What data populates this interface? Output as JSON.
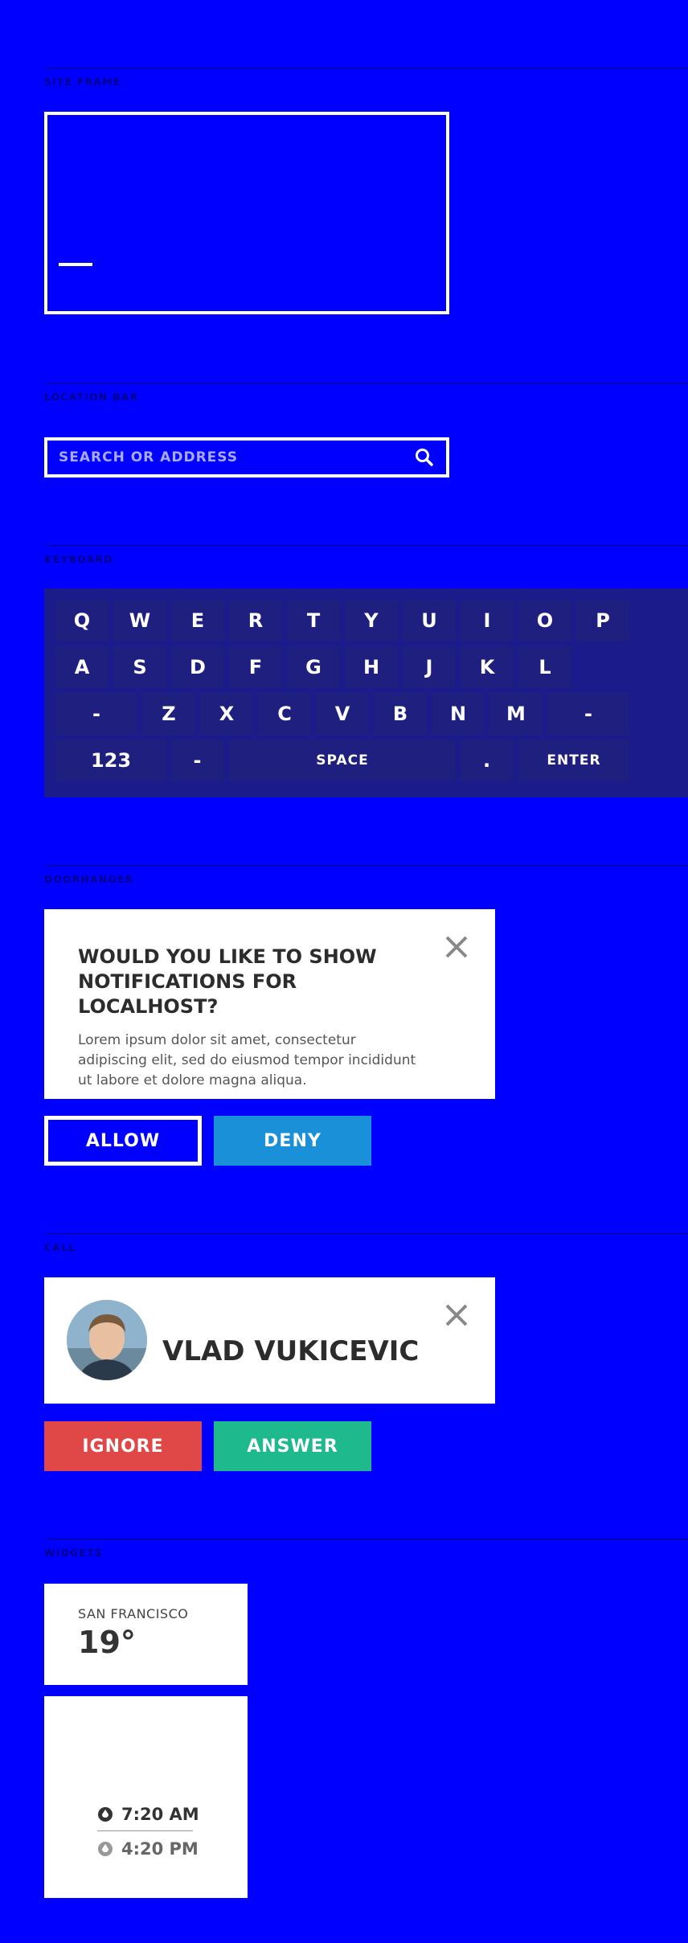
{
  "sections": {
    "site_frame": "SITE FRAME",
    "location_bar": "LOCATION BAR",
    "keyboard": "KEYBOARD",
    "doorhanger": "DOORHANGER",
    "call": "CALL",
    "widgets": "WIDGETS"
  },
  "location_bar": {
    "placeholder": "SEARCH OR ADDRESS"
  },
  "keyboard": {
    "row1": [
      "Q",
      "W",
      "E",
      "R",
      "T",
      "Y",
      "U",
      "I",
      "O",
      "P"
    ],
    "row2": [
      "A",
      "S",
      "D",
      "F",
      "G",
      "H",
      "J",
      "K",
      "L"
    ],
    "row3": [
      "-",
      "Z",
      "X",
      "C",
      "V",
      "B",
      "N",
      "M",
      "-"
    ],
    "row4": [
      "123",
      "-",
      "SPACE",
      ".",
      "ENTER"
    ]
  },
  "doorhanger": {
    "title": "WOULD YOU LIKE TO SHOW NOTIFICATIONS FOR LOCALHOST?",
    "body": "Lorem ipsum dolor sit amet, consectetur adipiscing elit, sed do eiusmod tempor incididunt ut labore et dolore magna aliqua.",
    "allow_label": "ALLOW",
    "deny_label": "DENY"
  },
  "call": {
    "caller_name": "VLAD VUKICEVIC",
    "ignore_label": "IGNORE",
    "answer_label": "ANSWER"
  },
  "widgets": {
    "weather": {
      "city": "SAN FRANCISCO",
      "temperature": "19°"
    },
    "sun": {
      "sunrise": "7:20 AM",
      "sunset": "4:20 PM"
    }
  },
  "colors": {
    "background": "#0000ff",
    "deny": "#1a90d8",
    "ignore": "#e04848",
    "answer": "#1fb98e"
  }
}
